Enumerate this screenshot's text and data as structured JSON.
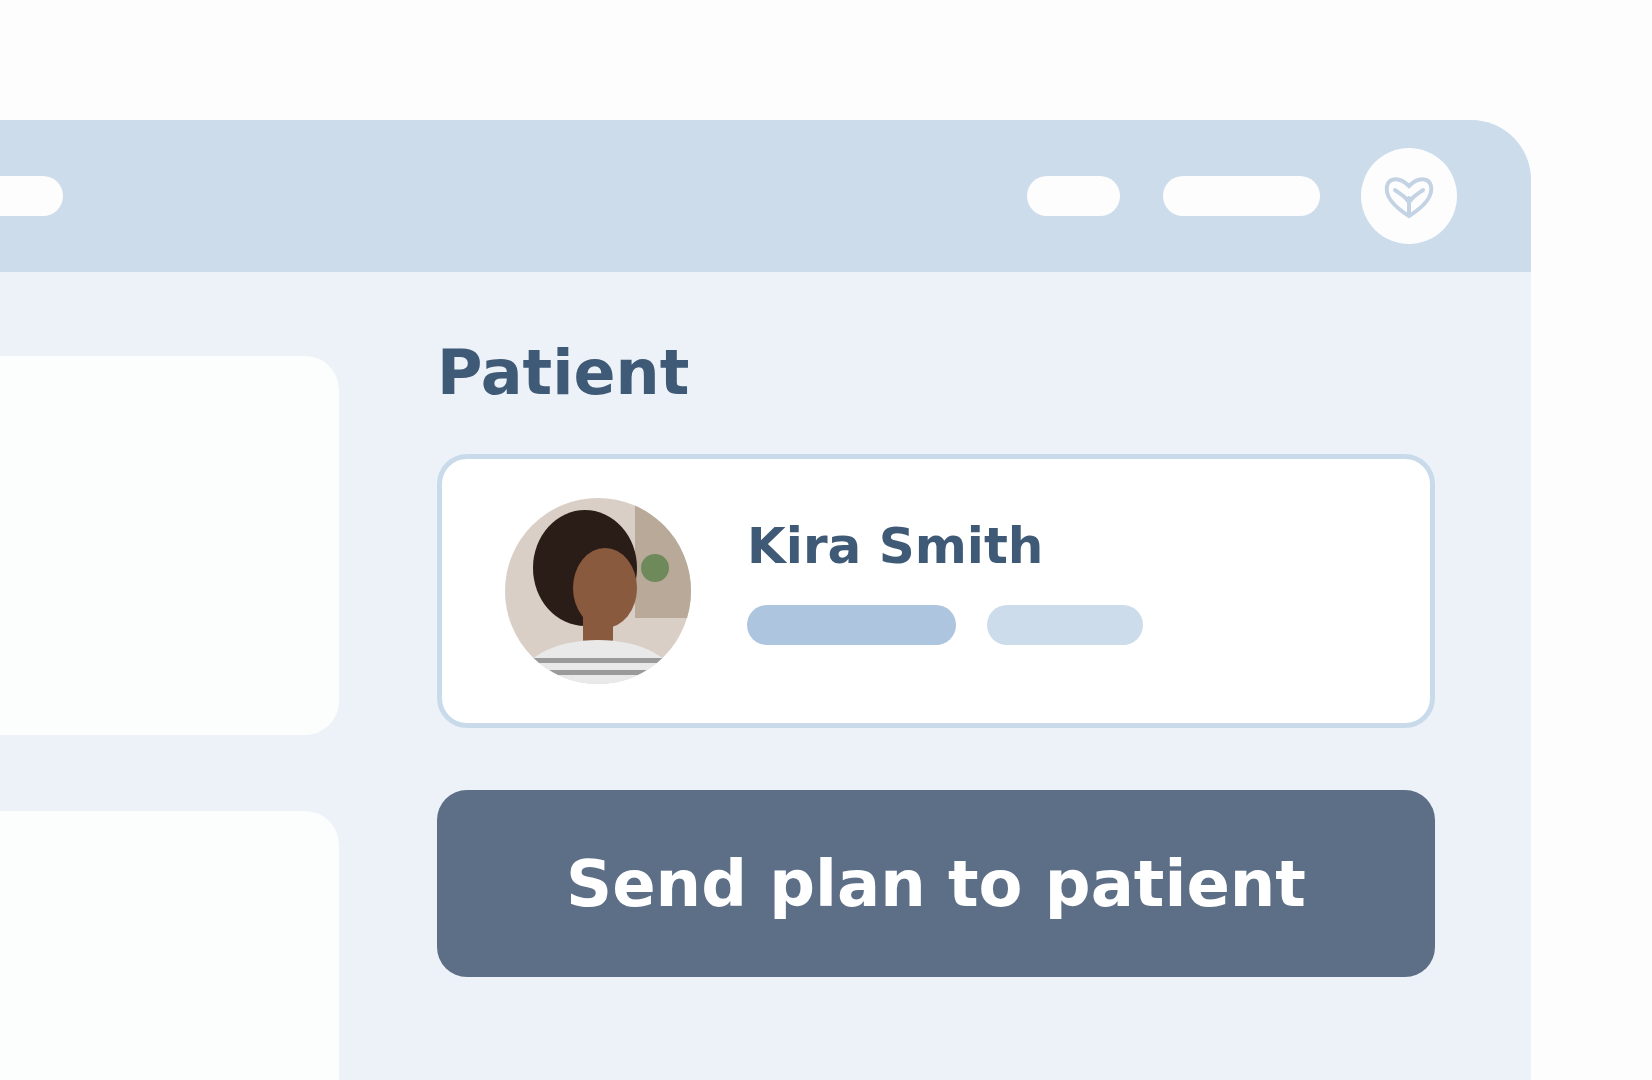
{
  "section_title": "Patient",
  "patient": {
    "name": "Kira Smith"
  },
  "action_button": {
    "label": "Send plan to patient"
  }
}
